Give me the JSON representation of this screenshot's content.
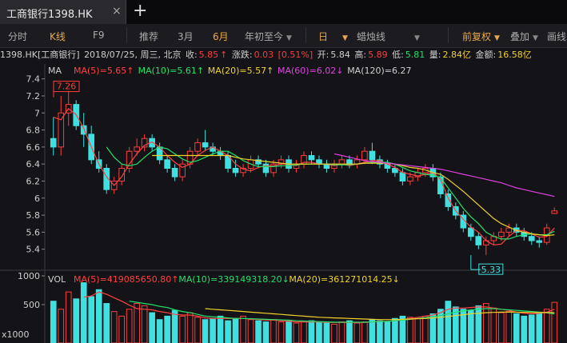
{
  "tab": {
    "title": "工商银行1398.HK",
    "close": "×",
    "add": "+"
  },
  "toolbar": {
    "fenshi": "分时",
    "kline": "K线",
    "f9": "F9",
    "tuijian": "推荐",
    "m3": "3月",
    "m6": "6月",
    "ytd": "年初至今",
    "period": "日",
    "style": "蜡烛线",
    "adjust": "前复权",
    "overlay": "叠加",
    "draw": "画线"
  },
  "info": {
    "code": "1398.HK[工商银行]",
    "date": "2018/07/25, 周三, 北京",
    "close_label": "收:",
    "close": "5.85",
    "chg_label": "涨跌:",
    "chg": "0.03",
    "pct": "[0.51%]",
    "open_label": "开:",
    "open": "5.84",
    "high_label": "高:",
    "high": "5.89",
    "low_label": "低:",
    "low": "5.81",
    "vol_label": "量:",
    "vol": "2.84亿",
    "amt_label": "金额:",
    "amt": "16.58亿"
  },
  "colors": {
    "up": "#ff3b3b",
    "down": "#40e0e0",
    "ma5": "#ff4040",
    "ma10": "#22e06a",
    "ma20": "#f0d22b",
    "ma60": "#e040e0",
    "ma120": "#cfcfcf"
  },
  "chart_data": [
    {
      "type": "candlestick",
      "title": "MA",
      "ylim": [
        5.2,
        7.5
      ],
      "yticks": [
        7.4,
        7.2,
        7,
        6.8,
        6.6,
        6.4,
        6.2,
        6,
        5.8,
        5.6,
        5.4
      ],
      "yticklabels": [
        "7.4",
        "7.2",
        "7",
        "6.8",
        "6.6",
        "6.4",
        "6.2",
        "6",
        "5.8",
        "5.6",
        "5.4"
      ],
      "legend": [
        {
          "key": "ma5",
          "text": "MA(5)=5.65",
          "arrow": "↑"
        },
        {
          "key": "ma10",
          "text": "MA(10)=5.61",
          "arrow": "↑"
        },
        {
          "key": "ma20",
          "text": "MA(20)=5.57",
          "arrow": "↑"
        },
        {
          "key": "ma60",
          "text": "MA(60)=6.02",
          "arrow": "↓"
        },
        {
          "key": "ma120",
          "text": "MA(120)=6.27",
          "arrow": ""
        }
      ],
      "annotations": [
        {
          "text": "7.26",
          "value": 7.26,
          "kind": "high"
        },
        {
          "text": "5.33",
          "value": 5.33,
          "kind": "low"
        }
      ],
      "series": [
        {
          "name": "MA(5)",
          "key": "ma5",
          "values": [
            6.95,
            6.92,
            7.05,
            6.98,
            6.82,
            6.6,
            6.4,
            6.25,
            6.15,
            6.25,
            6.4,
            6.52,
            6.62,
            6.66,
            6.6,
            6.5,
            6.42,
            6.36,
            6.4,
            6.5,
            6.56,
            6.6,
            6.55,
            6.5,
            6.4,
            6.34,
            6.32,
            6.36,
            6.38,
            6.38,
            6.4,
            6.4,
            6.38,
            6.42,
            6.42,
            6.4,
            6.4,
            6.38,
            6.4,
            6.38,
            6.4,
            6.42,
            6.44,
            6.44,
            6.4,
            6.36,
            6.3,
            6.28,
            6.26,
            6.28,
            6.3,
            6.22,
            6.0,
            5.85,
            5.75,
            5.66,
            5.6,
            5.5,
            5.45,
            5.46,
            5.55,
            5.62,
            5.62,
            5.58,
            5.54,
            5.55,
            5.65
          ]
        },
        {
          "name": "MA(10)",
          "key": "ma10",
          "values": [
            null,
            null,
            null,
            null,
            null,
            null,
            null,
            6.6,
            6.48,
            6.4,
            6.38,
            6.4,
            6.48,
            6.55,
            6.6,
            6.58,
            6.52,
            6.46,
            6.42,
            6.44,
            6.48,
            6.52,
            6.55,
            6.55,
            6.5,
            6.44,
            6.4,
            6.37,
            6.37,
            6.37,
            6.38,
            6.38,
            6.39,
            6.4,
            6.4,
            6.4,
            6.4,
            6.39,
            6.39,
            6.39,
            6.4,
            6.41,
            6.42,
            6.42,
            6.42,
            6.4,
            6.36,
            6.32,
            6.3,
            6.28,
            6.27,
            6.24,
            6.12,
            6.0,
            5.88,
            5.78,
            5.7,
            5.6,
            5.55,
            5.52,
            5.52,
            5.55,
            5.57,
            5.58,
            5.57,
            5.57,
            5.61
          ]
        },
        {
          "name": "MA(20)",
          "key": "ma20",
          "values": [
            null,
            null,
            null,
            null,
            null,
            null,
            null,
            null,
            null,
            null,
            null,
            null,
            null,
            6.5,
            6.5,
            6.5,
            6.5,
            6.5,
            6.5,
            6.5,
            6.5,
            6.5,
            6.5,
            6.5,
            6.48,
            6.46,
            6.45,
            6.44,
            6.43,
            6.42,
            6.41,
            6.4,
            6.4,
            6.4,
            6.4,
            6.4,
            6.4,
            6.4,
            6.4,
            6.4,
            6.4,
            6.41,
            6.41,
            6.41,
            6.41,
            6.4,
            6.38,
            6.36,
            6.35,
            6.33,
            6.3,
            6.28,
            6.22,
            6.15,
            6.08,
            6.0,
            5.92,
            5.84,
            5.76,
            5.7,
            5.66,
            5.62,
            5.6,
            5.58,
            5.57,
            5.56,
            5.57
          ]
        },
        {
          "name": "MA(60)",
          "key": "ma60",
          "values": [
            null,
            null,
            null,
            null,
            null,
            null,
            null,
            null,
            null,
            null,
            null,
            null,
            null,
            null,
            null,
            null,
            null,
            null,
            null,
            null,
            null,
            null,
            null,
            null,
            null,
            null,
            null,
            null,
            null,
            null,
            null,
            null,
            null,
            null,
            null,
            null,
            null,
            6.52,
            6.5,
            6.48,
            6.46,
            6.44,
            6.43,
            6.42,
            6.41,
            6.4,
            6.39,
            6.38,
            6.37,
            6.36,
            6.35,
            6.34,
            6.32,
            6.3,
            6.28,
            6.26,
            6.24,
            6.22,
            6.2,
            6.18,
            6.15,
            6.12,
            6.1,
            6.08,
            6.06,
            6.04,
            6.02
          ]
        },
        {
          "name": "MA(120)",
          "key": "ma120",
          "values": []
        }
      ],
      "candles": [
        {
          "o": 6.7,
          "h": 6.95,
          "l": 6.5,
          "c": 6.6
        },
        {
          "o": 6.6,
          "h": 7.2,
          "l": 6.5,
          "c": 7.0
        },
        {
          "o": 7.0,
          "h": 7.26,
          "l": 6.85,
          "c": 7.1
        },
        {
          "o": 7.1,
          "h": 7.15,
          "l": 6.8,
          "c": 6.85
        },
        {
          "o": 6.85,
          "h": 7.0,
          "l": 6.6,
          "c": 6.75
        },
        {
          "o": 6.75,
          "h": 6.85,
          "l": 6.4,
          "c": 6.45
        },
        {
          "o": 6.45,
          "h": 6.55,
          "l": 6.3,
          "c": 6.35
        },
        {
          "o": 6.35,
          "h": 6.4,
          "l": 6.05,
          "c": 6.1
        },
        {
          "o": 6.1,
          "h": 6.25,
          "l": 6.05,
          "c": 6.2
        },
        {
          "o": 6.2,
          "h": 6.4,
          "l": 6.15,
          "c": 6.35
        },
        {
          "o": 6.35,
          "h": 6.6,
          "l": 6.3,
          "c": 6.55
        },
        {
          "o": 6.55,
          "h": 6.7,
          "l": 6.5,
          "c": 6.6
        },
        {
          "o": 6.6,
          "h": 6.75,
          "l": 6.55,
          "c": 6.7
        },
        {
          "o": 6.7,
          "h": 6.75,
          "l": 6.55,
          "c": 6.6
        },
        {
          "o": 6.6,
          "h": 6.65,
          "l": 6.4,
          "c": 6.45
        },
        {
          "o": 6.45,
          "h": 6.5,
          "l": 6.3,
          "c": 6.35
        },
        {
          "o": 6.35,
          "h": 6.4,
          "l": 6.2,
          "c": 6.25
        },
        {
          "o": 6.25,
          "h": 6.45,
          "l": 6.2,
          "c": 6.4
        },
        {
          "o": 6.4,
          "h": 6.6,
          "l": 6.35,
          "c": 6.55
        },
        {
          "o": 6.55,
          "h": 6.7,
          "l": 6.5,
          "c": 6.65
        },
        {
          "o": 6.65,
          "h": 6.8,
          "l": 6.55,
          "c": 6.6
        },
        {
          "o": 6.6,
          "h": 6.65,
          "l": 6.5,
          "c": 6.55
        },
        {
          "o": 6.55,
          "h": 6.6,
          "l": 6.45,
          "c": 6.5
        },
        {
          "o": 6.5,
          "h": 6.55,
          "l": 6.3,
          "c": 6.35
        },
        {
          "o": 6.35,
          "h": 6.45,
          "l": 6.25,
          "c": 6.3
        },
        {
          "o": 6.3,
          "h": 6.4,
          "l": 6.25,
          "c": 6.35
        },
        {
          "o": 6.35,
          "h": 6.5,
          "l": 6.3,
          "c": 6.45
        },
        {
          "o": 6.45,
          "h": 6.5,
          "l": 6.35,
          "c": 6.4
        },
        {
          "o": 6.4,
          "h": 6.45,
          "l": 6.25,
          "c": 6.3
        },
        {
          "o": 6.3,
          "h": 6.45,
          "l": 6.25,
          "c": 6.4
        },
        {
          "o": 6.4,
          "h": 6.5,
          "l": 6.35,
          "c": 6.45
        },
        {
          "o": 6.45,
          "h": 6.5,
          "l": 6.3,
          "c": 6.35
        },
        {
          "o": 6.35,
          "h": 6.45,
          "l": 6.3,
          "c": 6.4
        },
        {
          "o": 6.4,
          "h": 6.55,
          "l": 6.35,
          "c": 6.5
        },
        {
          "o": 6.5,
          "h": 6.55,
          "l": 6.4,
          "c": 6.45
        },
        {
          "o": 6.45,
          "h": 6.5,
          "l": 6.35,
          "c": 6.4
        },
        {
          "o": 6.4,
          "h": 6.45,
          "l": 6.3,
          "c": 6.35
        },
        {
          "o": 6.35,
          "h": 6.45,
          "l": 6.3,
          "c": 6.4
        },
        {
          "o": 6.4,
          "h": 6.5,
          "l": 6.35,
          "c": 6.45
        },
        {
          "o": 6.45,
          "h": 6.5,
          "l": 6.35,
          "c": 6.4
        },
        {
          "o": 6.4,
          "h": 6.5,
          "l": 6.35,
          "c": 6.45
        },
        {
          "o": 6.45,
          "h": 6.6,
          "l": 6.4,
          "c": 6.55
        },
        {
          "o": 6.55,
          "h": 6.65,
          "l": 6.4,
          "c": 6.45
        },
        {
          "o": 6.45,
          "h": 6.5,
          "l": 6.35,
          "c": 6.4
        },
        {
          "o": 6.4,
          "h": 6.45,
          "l": 6.3,
          "c": 6.35
        },
        {
          "o": 6.35,
          "h": 6.4,
          "l": 6.25,
          "c": 6.3
        },
        {
          "o": 6.3,
          "h": 6.35,
          "l": 6.15,
          "c": 6.2
        },
        {
          "o": 6.2,
          "h": 6.3,
          "l": 6.15,
          "c": 6.25
        },
        {
          "o": 6.25,
          "h": 6.35,
          "l": 6.2,
          "c": 6.3
        },
        {
          "o": 6.3,
          "h": 6.4,
          "l": 6.25,
          "c": 6.35
        },
        {
          "o": 6.35,
          "h": 6.4,
          "l": 6.2,
          "c": 6.25
        },
        {
          "o": 6.25,
          "h": 6.3,
          "l": 6.0,
          "c": 6.05
        },
        {
          "o": 6.05,
          "h": 6.1,
          "l": 5.85,
          "c": 5.9
        },
        {
          "o": 5.9,
          "h": 5.95,
          "l": 5.75,
          "c": 5.8
        },
        {
          "o": 5.8,
          "h": 5.85,
          "l": 5.6,
          "c": 5.65
        },
        {
          "o": 5.65,
          "h": 5.7,
          "l": 5.5,
          "c": 5.55
        },
        {
          "o": 5.55,
          "h": 5.6,
          "l": 5.4,
          "c": 5.45
        },
        {
          "o": 5.45,
          "h": 5.55,
          "l": 5.33,
          "c": 5.5
        },
        {
          "o": 5.5,
          "h": 5.6,
          "l": 5.45,
          "c": 5.55
        },
        {
          "o": 5.55,
          "h": 5.65,
          "l": 5.5,
          "c": 5.6
        },
        {
          "o": 5.6,
          "h": 5.7,
          "l": 5.55,
          "c": 5.65
        },
        {
          "o": 5.65,
          "h": 5.7,
          "l": 5.55,
          "c": 5.6
        },
        {
          "o": 5.6,
          "h": 5.65,
          "l": 5.5,
          "c": 5.55
        },
        {
          "o": 5.55,
          "h": 5.6,
          "l": 5.45,
          "c": 5.5
        },
        {
          "o": 5.5,
          "h": 5.55,
          "l": 5.42,
          "c": 5.48
        },
        {
          "o": 5.48,
          "h": 5.7,
          "l": 5.45,
          "c": 5.65
        },
        {
          "o": 5.82,
          "h": 5.89,
          "l": 5.81,
          "c": 5.85
        }
      ]
    },
    {
      "type": "bar",
      "title": "VOL",
      "ylim": [
        0,
        1000
      ],
      "yticks": [
        1000,
        500
      ],
      "yticklabels": [
        "1000",
        "500"
      ],
      "unit_label": "x1000",
      "legend": [
        {
          "key": "ma5",
          "text": "MA(5)=419085650.80",
          "arrow": "↑"
        },
        {
          "key": "ma10",
          "text": "MA(10)=339149318.20",
          "arrow": "↓"
        },
        {
          "key": "ma20",
          "text": "MA(20)=361271014.25",
          "arrow": "↓"
        }
      ],
      "values": [
        560,
        420,
        720,
        600,
        880,
        640,
        760,
        520,
        380,
        300,
        420,
        520,
        480,
        360,
        240,
        300,
        400,
        300,
        360,
        280,
        240,
        260,
        300,
        220,
        260,
        300,
        240,
        220,
        200,
        240,
        200,
        220,
        180,
        200,
        220,
        200,
        180,
        160,
        200,
        220,
        180,
        200,
        240,
        220,
        200,
        260,
        300,
        280,
        260,
        300,
        340,
        420,
        560,
        460,
        420,
        400,
        480,
        520,
        440,
        360,
        380,
        340,
        300,
        320,
        360,
        420,
        540
      ],
      "series": [
        {
          "name": "MA(5)",
          "key": "ma5",
          "values": [
            null,
            null,
            null,
            null,
            630,
            650,
            720,
            680,
            620,
            560,
            490,
            430,
            420,
            410,
            380,
            360,
            330,
            320,
            320,
            300,
            270,
            260,
            260,
            260,
            260,
            260,
            250,
            240,
            230,
            230,
            220,
            210,
            200,
            200,
            200,
            200,
            190,
            190,
            190,
            190,
            190,
            190,
            200,
            210,
            210,
            220,
            240,
            260,
            280,
            300,
            320,
            360,
            420,
            440,
            440,
            450,
            460,
            460,
            440,
            420,
            400,
            370,
            350,
            340,
            350,
            370,
            419
          ]
        },
        {
          "name": "MA(10)",
          "key": "ma10",
          "values": [
            null,
            null,
            null,
            null,
            null,
            null,
            null,
            null,
            null,
            null,
            560,
            540,
            520,
            500,
            470,
            450,
            410,
            380,
            360,
            330,
            300,
            290,
            280,
            270,
            260,
            260,
            255,
            250,
            245,
            240,
            235,
            230,
            220,
            215,
            210,
            205,
            200,
            195,
            195,
            195,
            195,
            195,
            200,
            205,
            210,
            220,
            230,
            245,
            260,
            275,
            290,
            310,
            340,
            370,
            390,
            410,
            420,
            430,
            430,
            420,
            410,
            400,
            390,
            380,
            370,
            360,
            339
          ]
        },
        {
          "name": "MA(20)",
          "key": "ma20",
          "values": [
            null,
            null,
            null,
            null,
            null,
            null,
            null,
            null,
            null,
            null,
            null,
            null,
            null,
            null,
            null,
            null,
            null,
            null,
            null,
            null,
            430,
            420,
            410,
            400,
            390,
            380,
            370,
            360,
            350,
            340,
            330,
            320,
            310,
            300,
            290,
            280,
            275,
            270,
            265,
            260,
            255,
            250,
            245,
            240,
            240,
            240,
            245,
            250,
            255,
            260,
            270,
            280,
            295,
            310,
            325,
            340,
            350,
            360,
            365,
            370,
            370,
            368,
            366,
            364,
            362,
            361,
            361
          ]
        }
      ]
    }
  ]
}
